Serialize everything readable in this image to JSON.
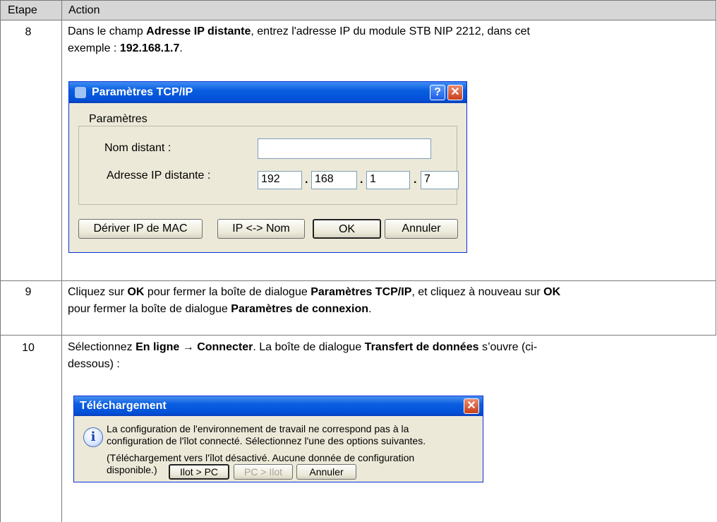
{
  "table": {
    "headers": {
      "step": "Etape",
      "action": "Action"
    },
    "rows": [
      {
        "step": "8",
        "line1_pre": "Dans le champ ",
        "line1_b1": "Adresse IP distante",
        "line1_post": ", entrez l'adresse IP du module STB NIP 2212, dans cet",
        "line2_pre": "exemple : ",
        "line2_b": "192.168.1.7",
        "line2_post": "."
      },
      {
        "step": "9",
        "line1_pre": "Cliquez sur ",
        "line1_b1": "OK",
        "line1_mid": " pour fermer la boîte de dialogue ",
        "line1_b2": "Paramètres TCP/IP",
        "line1_mid2": ", et cliquez à nouveau sur ",
        "line1_b3": "OK",
        "line2_pre": "pour fermer la boîte de dialogue ",
        "line2_b": "Paramètres de connexion",
        "line2_post": "."
      },
      {
        "step": "10",
        "line1_pre": "Sélectionnez ",
        "line1_b1": "En ligne",
        "line1_arrow": " → ",
        "line1_b2": "Connecter",
        "line1_mid": ". La boîte de dialogue ",
        "line1_b3": "Transfert de données",
        "line1_post": " s’ouvre (ci-",
        "line2": "dessous) :"
      }
    ]
  },
  "dialog_tcpip": {
    "title": "Paramètres TCP/IP",
    "help_btn": "?",
    "close_btn": "✕",
    "group_label": "Paramètres",
    "remote_name_label": "Nom distant :",
    "remote_name_value": "",
    "remote_ip_label": "Adresse IP distante :",
    "ip_octets": [
      "192",
      "168",
      "1",
      "7"
    ],
    "buttons": {
      "derive": "Dériver IP de MAC",
      "ipname": "IP <-> Nom",
      "ok": "OK",
      "cancel": "Annuler"
    }
  },
  "dialog_download": {
    "title": "Téléchargement",
    "close_btn": "✕",
    "msg1": "La configuration de l'environnement de travail ne correspond pas à la",
    "msg2": "configuration de l'îlot connecté. Sélectionnez l'une des options suivantes.",
    "msg3": "(Téléchargement vers l'îlot désactivé. Aucune donnée de configuration",
    "msg4": "disponible.)",
    "buttons": {
      "island_pc": "Ilot > PC",
      "pc_island": "PC > Ilot",
      "cancel": "Annuler"
    }
  }
}
